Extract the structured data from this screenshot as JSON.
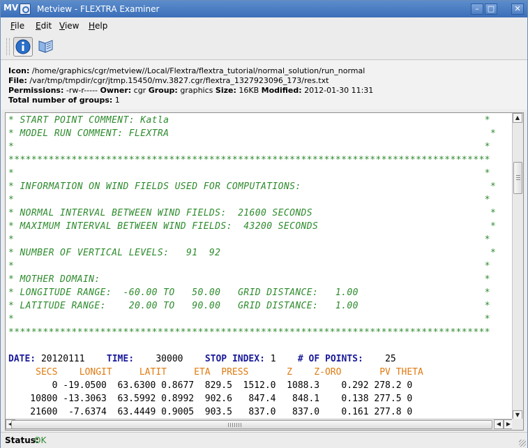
{
  "window": {
    "title": "Metview - FLEXTRA Examiner",
    "app_logo_text": "MV",
    "controls": {
      "minimize": "–",
      "maximize": "□",
      "close": "✕"
    }
  },
  "menubar": {
    "items": [
      {
        "label": "File",
        "accel": "F",
        "rest": "ile"
      },
      {
        "label": "Edit",
        "accel": "E",
        "rest": "dit"
      },
      {
        "label": "View",
        "accel": "V",
        "rest": "iew"
      },
      {
        "label": "Help",
        "accel": "H",
        "rest": "elp"
      }
    ]
  },
  "toolbar": {
    "buttons": [
      {
        "icon": "info-icon",
        "active": true
      },
      {
        "icon": "book-icon",
        "active": false
      }
    ]
  },
  "info": {
    "icon_label": "Icon:",
    "icon_value": "/home/graphics/cgr/metview//Local/Flextra/flextra_tutorial/normal_solution/run_normal",
    "file_label": "File:",
    "file_value": "/var/tmp/tmpdir/cgr/jtmp.15450/mv.3827.cgr/flextra_1327923096_173/res.txt",
    "permissions_label": "Permissions:",
    "permissions_value": "-rw-r-----",
    "owner_label": "Owner:",
    "owner_value": "cgr",
    "group_label": "Group:",
    "group_value": "graphics",
    "size_label": "Size:",
    "size_value": "16KB",
    "modified_label": "Modified:",
    "modified_value": "2012-01-30 11:31",
    "groups_label": "Total number of groups:",
    "groups_value": "1"
  },
  "text": {
    "comment_lines": [
      "* START POINT COMMENT: Katla                                                       *",
      "* MODEL RUN COMMENT: FLEXTRA                                                        *",
      "*                                                                                  *",
      "************************************************************************************",
      "*                                                                                  *",
      "* INFORMATION ON WIND FIELDS USED FOR COMPUTATIONS:                                 *",
      "*                                                                                  *",
      "* NORMAL INTERVAL BETWEEN WIND FIELDS:  21600 SECONDS                               *",
      "* MAXIMUM INTERVAL BETWEEN WIND FIELDS:  43200 SECONDS                              *",
      "*                                                                                  *",
      "* NUMBER OF VERTICAL LEVELS:   91  92                                               *",
      "*                                                                                  *",
      "* MOTHER DOMAIN:                                                                   *",
      "* LONGITUDE RANGE:  -60.00 TO   50.00   GRID DISTANCE:   1.00                      *",
      "* LATITUDE RANGE:    20.00 TO   90.00   GRID DISTANCE:   1.00                      *",
      "*                                                                                  *",
      "************************************************************************************"
    ],
    "header": {
      "date_label": "DATE:",
      "date_value": "20120111",
      "time_label": "TIME:",
      "time_value": "30000",
      "stop_label": "STOP INDEX:",
      "stop_value": "1",
      "points_label": "# OF POINTS:",
      "points_value": "25"
    },
    "columns": "     SECS    LONGIT     LATIT     ETA  PRESS       Z    Z-ORO       PV THETA",
    "rows": [
      "        0 -19.0500  63.6300 0.8677  829.5  1512.0  1088.3    0.292 278.2 0",
      "    10800 -13.3063  63.5992 0.8992  902.6   847.4   848.1    0.138 277.5 0",
      "    21600  -7.6374  63.4449 0.9005  903.5   837.0   837.0    0.161 277.8 0"
    ]
  },
  "status": {
    "label": "Status:",
    "value": "OK"
  }
}
